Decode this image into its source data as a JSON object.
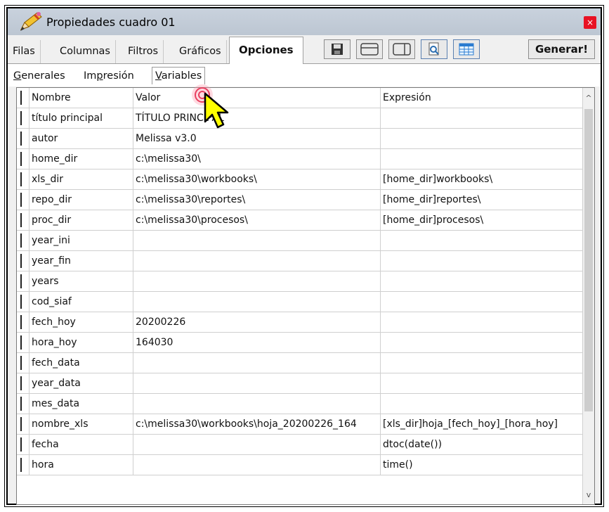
{
  "window": {
    "title": "Propiedades cuadro 01",
    "close_glyph": "×"
  },
  "tabs": [
    {
      "label": "Filas"
    },
    {
      "label": "Columnas"
    },
    {
      "label": "Filtros"
    },
    {
      "label": "Gráficos"
    },
    {
      "label": "Opciones",
      "active": true
    }
  ],
  "toolbar": {
    "icons": [
      "save-icon",
      "layout-stacked-icon",
      "layout-columns-icon",
      "preview-icon",
      "table-icon"
    ],
    "generate_label": "Generar!"
  },
  "subtabs": [
    {
      "label": "Generales",
      "underline": "G"
    },
    {
      "label": "Impresión",
      "underline": "p"
    },
    {
      "label": "Variables",
      "underline": "V",
      "active": true
    }
  ],
  "table": {
    "headers": [
      "Nombre",
      "Valor",
      "Expresión"
    ],
    "rows": [
      [
        "título principal",
        "TÍTULO PRINCIPAL",
        ""
      ],
      [
        "autor",
        "Melissa v3.0",
        ""
      ],
      [
        "home_dir",
        "c:\\melissa30\\",
        ""
      ],
      [
        "xls_dir",
        "c:\\melissa30\\workbooks\\",
        "[home_dir]workbooks\\"
      ],
      [
        "repo_dir",
        "c:\\melissa30\\reportes\\",
        "[home_dir]reportes\\"
      ],
      [
        "proc_dir",
        "c:\\melissa30\\procesos\\",
        "[home_dir]procesos\\"
      ],
      [
        "year_ini",
        "",
        ""
      ],
      [
        "year_fin",
        "",
        ""
      ],
      [
        "years",
        "",
        ""
      ],
      [
        "cod_siaf",
        "",
        ""
      ],
      [
        "fech_hoy",
        "20200226",
        ""
      ],
      [
        "hora_hoy",
        "164030",
        ""
      ],
      [
        "fech_data",
        "",
        ""
      ],
      [
        "year_data",
        "",
        ""
      ],
      [
        "mes_data",
        "",
        ""
      ],
      [
        "nombre_xls",
        "c:\\melissa30\\workbooks\\hoja_20200226_164",
        "[xls_dir]hoja_[fech_hoy]_[hora_hoy]"
      ],
      [
        "fecha",
        "",
        "dtoc(date())"
      ],
      [
        "hora",
        "",
        "time()"
      ]
    ]
  },
  "colors": {
    "titlebar": "#c3ccd7",
    "close": "#e81123",
    "cursor": "#ffff00"
  }
}
